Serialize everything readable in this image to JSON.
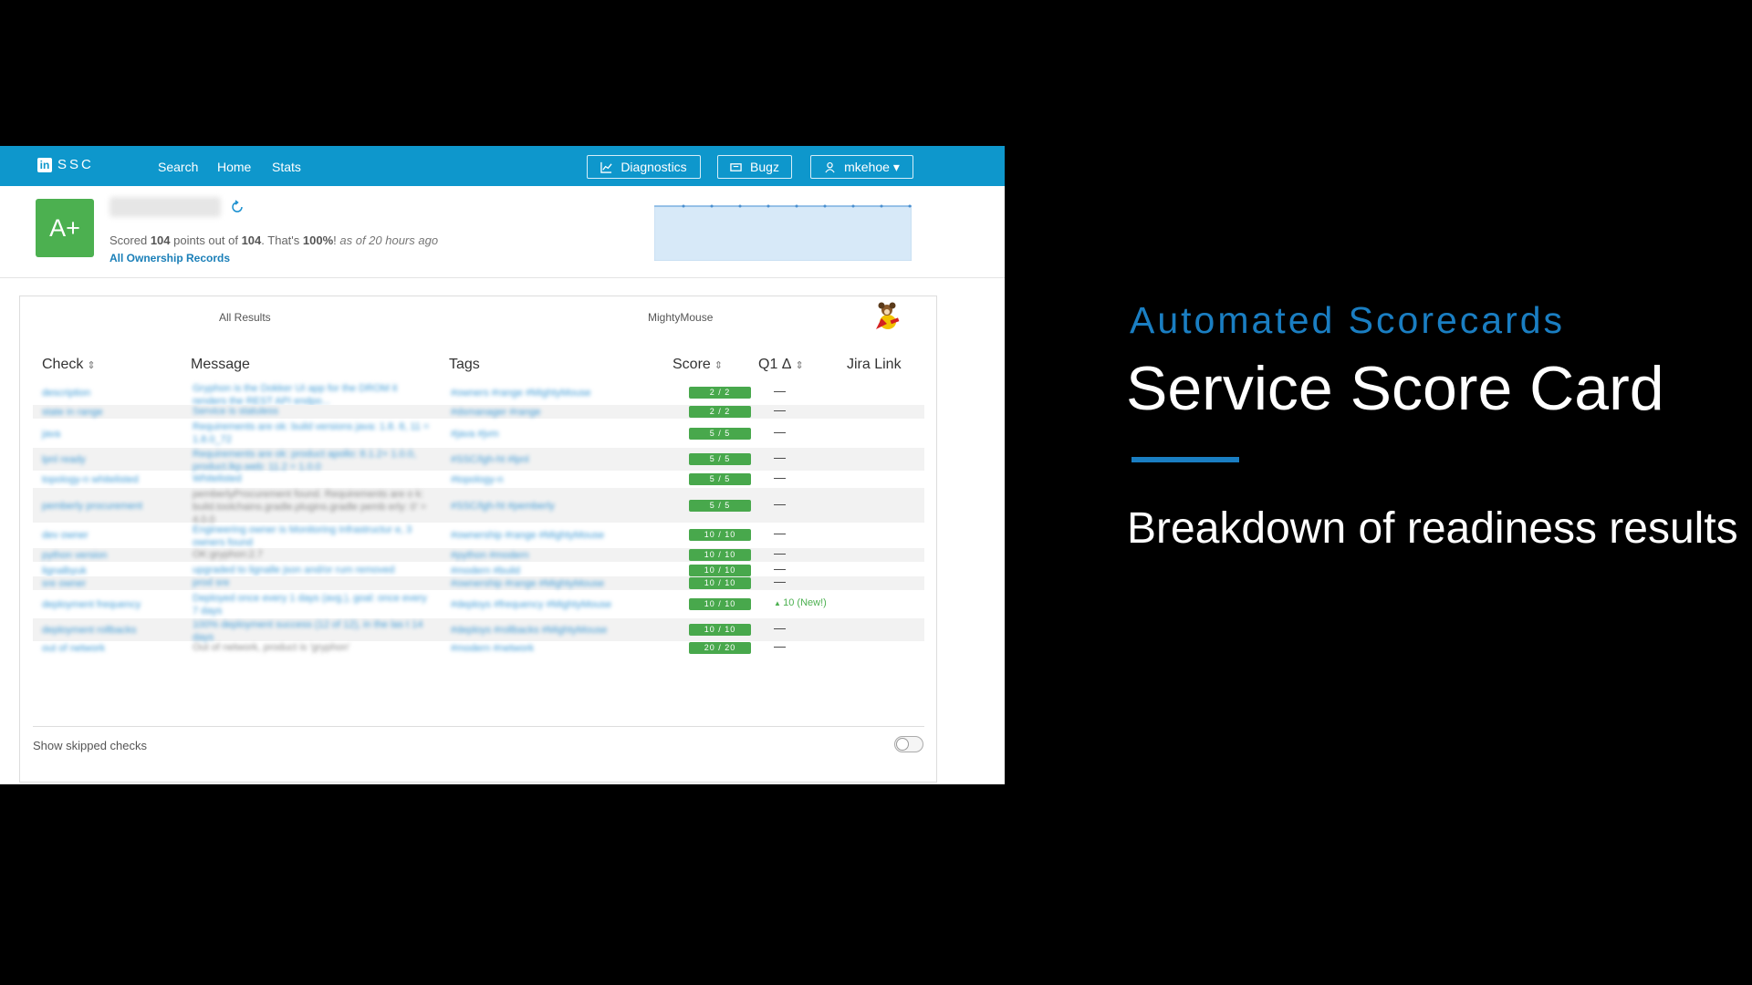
{
  "navbar": {
    "brand": "SSC",
    "links": [
      "Search",
      "Home",
      "Stats"
    ],
    "buttons": {
      "diagnostics": "Diagnostics",
      "bugz": "Bugz",
      "user": "mkehoe ▾"
    }
  },
  "service": {
    "grade": "A+",
    "score_prefix": "Scored ",
    "score_points": "104",
    "score_mid": " points out of ",
    "score_total": "104",
    "score_mid2": ". That's ",
    "score_pct": "100%",
    "score_sep": "! ",
    "score_time": "as of 20 hours ago",
    "ownership_link": "All Ownership Records"
  },
  "tabs": [
    "All Results",
    "MightyMouse"
  ],
  "table": {
    "headers": {
      "check": "Check",
      "message": "Message",
      "tags": "Tags",
      "score": "Score",
      "q1": "Q1 Δ",
      "jira": "Jira Link"
    },
    "sort_icon": "⇕",
    "rows": [
      {
        "check": "description",
        "message": "Gryphon is the Dokker UI app for the DROM it renders the REST API endpo...",
        "tags": "#owners #range #MightyMouse",
        "score": "2 / 2",
        "delta": "—"
      },
      {
        "check": "state in range",
        "message": "Service is statuless",
        "tags": "#dsmanager #range",
        "score": "2 / 2",
        "delta": "—"
      },
      {
        "check": "java",
        "message": "Requirements are ok: build versions java: 1.8. 8, 11 = 1.8.0_72",
        "tags": "#java #jvm",
        "score": "5 / 5",
        "delta": "—"
      },
      {
        "check": "lpnl ready",
        "message": "Requirements are ok: product apollo: 8.1.2+ 1.0.0, product.lkp.web: 11.2 = 1.0.0",
        "tags": "#SSC/lgh-ht #lpnl",
        "score": "5 / 5",
        "delta": "—"
      },
      {
        "check": "topology-n whitelisted",
        "message": "Whitelisted",
        "tags": "#topology-n",
        "score": "5 / 5",
        "delta": "—"
      },
      {
        "check": "pemberly procurement",
        "message": "pemberlyProcurement found. Requirements are o k: build.toolchains.gradle.plugins.gradle pemb erly: 0' = 4.0.0",
        "tags": "#SSC/lgh-ht #pemberly",
        "score": "5 / 5",
        "delta": "—",
        "plain": true
      },
      {
        "check": "dev owner",
        "message": "Engineering owner is Monitoring Infrastructur e, 3 owners found",
        "tags": "#ownership #range #MightyMouse",
        "score": "10 / 10",
        "delta": "—"
      },
      {
        "check": "python version",
        "message": "OK:gryphon:2.7",
        "tags": "#python #modern",
        "score": "10 / 10",
        "delta": "—",
        "plain": true
      },
      {
        "check": "lignalbyuk",
        "message": "upgraded to lignalle json and/or rum removed",
        "tags": "#modern #build",
        "score": "10 / 10",
        "delta": "—"
      },
      {
        "check": "sre owner",
        "message": "prod sre",
        "tags": "#ownership #range #MightyMouse",
        "score": "10 / 10",
        "delta": "—"
      },
      {
        "check": "deployment frequency",
        "message": "Deployed once every 1 days (avg.), goal: once every 7 days",
        "tags": "#deploys #frequency #MightyMouse",
        "score": "10 / 10",
        "delta": "10 (New!)",
        "new": true
      },
      {
        "check": "deployment rollbacks",
        "message": "100% deployment success (12 of 12), in the las t 14 days",
        "tags": "#deploys #rollbacks #MightyMouse",
        "score": "10 / 10",
        "delta": "—"
      },
      {
        "check": "out of network",
        "message": "Out of network, product is 'gryphon'",
        "tags": "#modern #network",
        "score": "20 / 20",
        "delta": "—",
        "plain": true
      }
    ]
  },
  "footer": {
    "skipped_label": "Show skipped checks"
  },
  "slide": {
    "subtitle": "Automated Scorecards",
    "title": "Service Score Card",
    "body": "Breakdown of readiness results"
  },
  "colors": {
    "nav": "#0e97cc",
    "grade": "#4cb050",
    "score_badge": "#48a84c",
    "accent": "#1a7ec2"
  },
  "icons": {
    "brand": "linkedin-icon",
    "diagnostics": "chart-icon",
    "bugz": "bug-ticket-icon",
    "user": "user-icon",
    "refresh": "refresh-icon",
    "mascot": "mighty-mouse-icon"
  }
}
